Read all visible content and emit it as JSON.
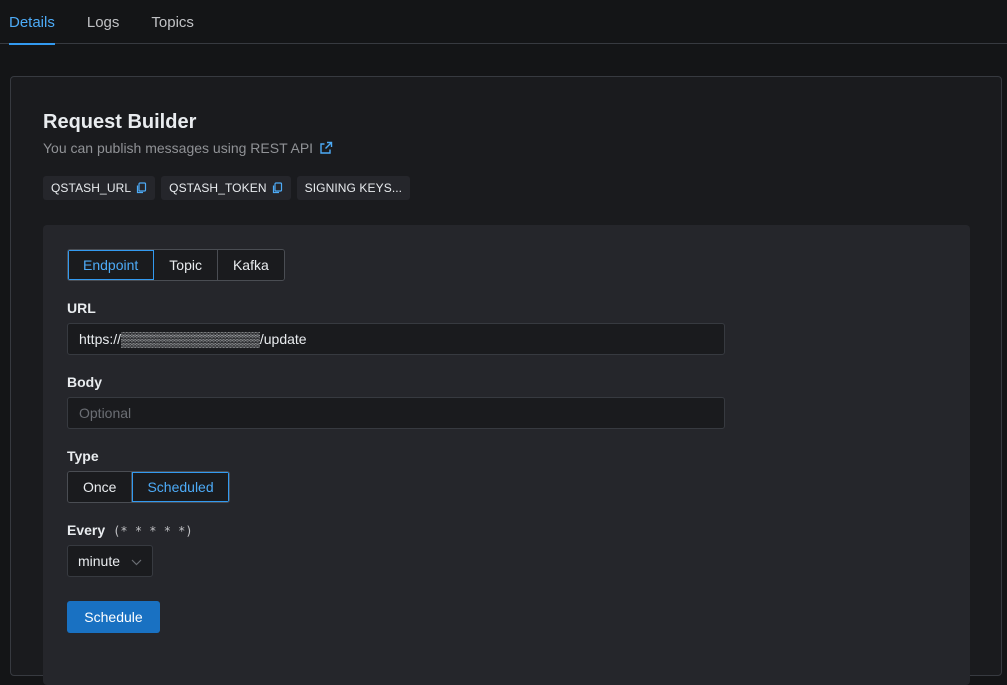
{
  "tabs": [
    {
      "label": "Details",
      "active": true
    },
    {
      "label": "Logs",
      "active": false
    },
    {
      "label": "Topics",
      "active": false
    }
  ],
  "builder": {
    "title": "Request Builder",
    "subtitle": "You can publish messages using REST API",
    "keys": [
      "QSTASH_URL",
      "QSTASH_TOKEN",
      "SIGNING KEYS..."
    ]
  },
  "form": {
    "target_tabs": [
      {
        "label": "Endpoint",
        "active": true
      },
      {
        "label": "Topic",
        "active": false
      },
      {
        "label": "Kafka",
        "active": false
      }
    ],
    "url_label": "URL",
    "url_value": "https://▒▒▒▒▒▒▒▒▒▒▒▒▒▒/update",
    "body_label": "Body",
    "body_placeholder": "Optional",
    "type_label": "Type",
    "type_options": [
      {
        "label": "Once",
        "active": false
      },
      {
        "label": "Scheduled",
        "active": true
      }
    ],
    "every_label": "Every",
    "cron_hint": "(* * * * *)",
    "every_value": "minute",
    "submit_label": "Schedule"
  },
  "colors": {
    "accent": "#4dabf7",
    "primary_button": "#1971c2",
    "background": "#141517",
    "card": "#1a1b1e",
    "panel": "#25262b"
  }
}
